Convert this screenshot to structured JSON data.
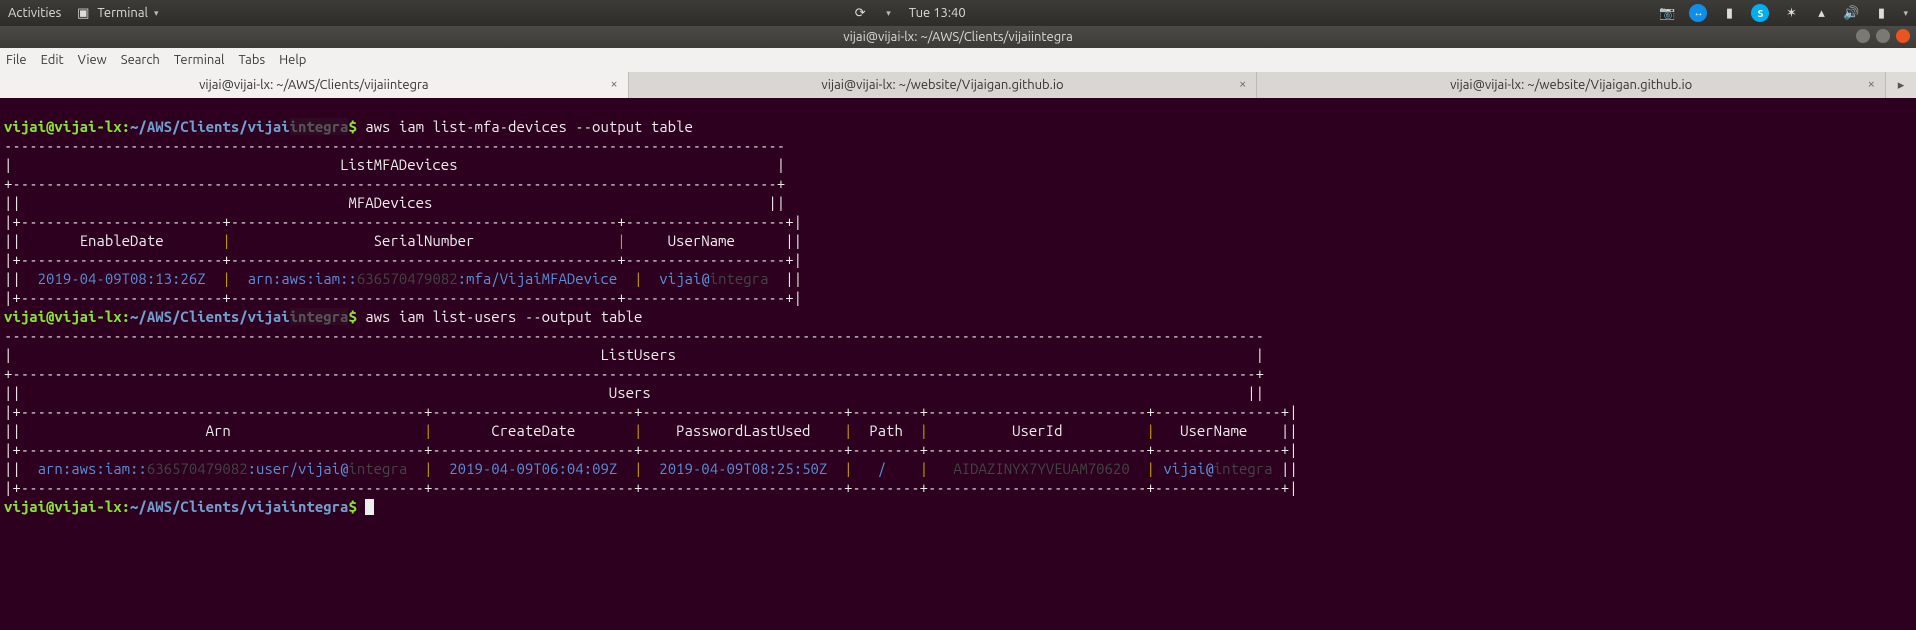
{
  "gnome": {
    "activities": "Activities",
    "app_name": "Terminal",
    "clock": "Tue 13:40"
  },
  "window": {
    "title": "vijai@vijai-lx: ~/AWS/Clients/vijaiintegra"
  },
  "menubar": [
    "File",
    "Edit",
    "View",
    "Search",
    "Terminal",
    "Tabs",
    "Help"
  ],
  "tabs": [
    {
      "label": "vijai@vijai-lx: ~/AWS/Clients/vijaiintegra",
      "active": true
    },
    {
      "label": "vijai@vijai-lx: ~/website/Vijaigan.github.io",
      "active": false
    },
    {
      "label": "vijai@vijai-lx: ~/website/Vijaigan.github.io",
      "active": false
    }
  ],
  "prompt": {
    "userhost": "vijai@vijai-lx",
    "colon": ":",
    "path_prefix": "~/AWS/Clients/vijai",
    "path_redacted": "integra",
    "dollar": "$"
  },
  "cmd1": " aws iam list-mfa-devices --output table",
  "cmd2": " aws iam list-users --output table",
  "mfa": {
    "dashes1": "---------------------------------------------------------------------------------------------",
    "title": "|                                       ListMFADevices                                      |",
    "dashes2": "+-------------------------------------------------------------------------------------------+",
    "subtitle": "||                                       MFADevices                                        ||",
    "sep": "|+------------------------+----------------------------------------------+-------------------+|",
    "hdr_enable": "       EnableDate       ",
    "hdr_serial": "                 SerialNumber                 ",
    "hdr_user": "     UserName      ",
    "val_enable": "  2019-04-09T08:13:26Z  ",
    "val_serial_pre": "  arn:aws:iam::",
    "val_serial_red": "636570479082",
    "val_serial_post": ":mfa/VijaiMFADevice  ",
    "val_user_pre": "  vijai@",
    "val_user_red": "integra",
    "val_user_post": "  "
  },
  "users": {
    "dashes1": "------------------------------------------------------------------------------------------------------------------------------------------------------",
    "title": "|                                                                      ListUsers                                                                     |",
    "dashes2": "+----------------------------------------------------------------------------------------------------------------------------------------------------+",
    "subtitle": "||                                                                      Users                                                                       ||",
    "sep": "|+------------------------------------------------+------------------------+------------------------+--------+--------------------------+---------------+|",
    "hdr_arn": "                      Arn                       ",
    "hdr_create": "       CreateDate       ",
    "hdr_pwd": "    PasswordLastUsed    ",
    "hdr_path": "  Path  ",
    "hdr_uid": "          UserId          ",
    "hdr_uname": "   UserName    ",
    "val_arn_pre": "  arn:aws:iam::",
    "val_arn_red1": "636570479082",
    "val_arn_mid": ":user/vijai@",
    "val_arn_red2": "integra",
    "val_arn_post": "  ",
    "val_create": "  2019-04-09T06:04:09Z  ",
    "val_pwd": "  2019-04-09T08:25:50Z  ",
    "val_path": "   /    ",
    "val_uid_pre": "   ",
    "val_uid_red": "AIDAZINYX7YVEUAM70620",
    "val_uid_post": "  ",
    "val_uname_pre": " vijai@",
    "val_uname_red": "integra",
    "val_uname_post": " "
  }
}
